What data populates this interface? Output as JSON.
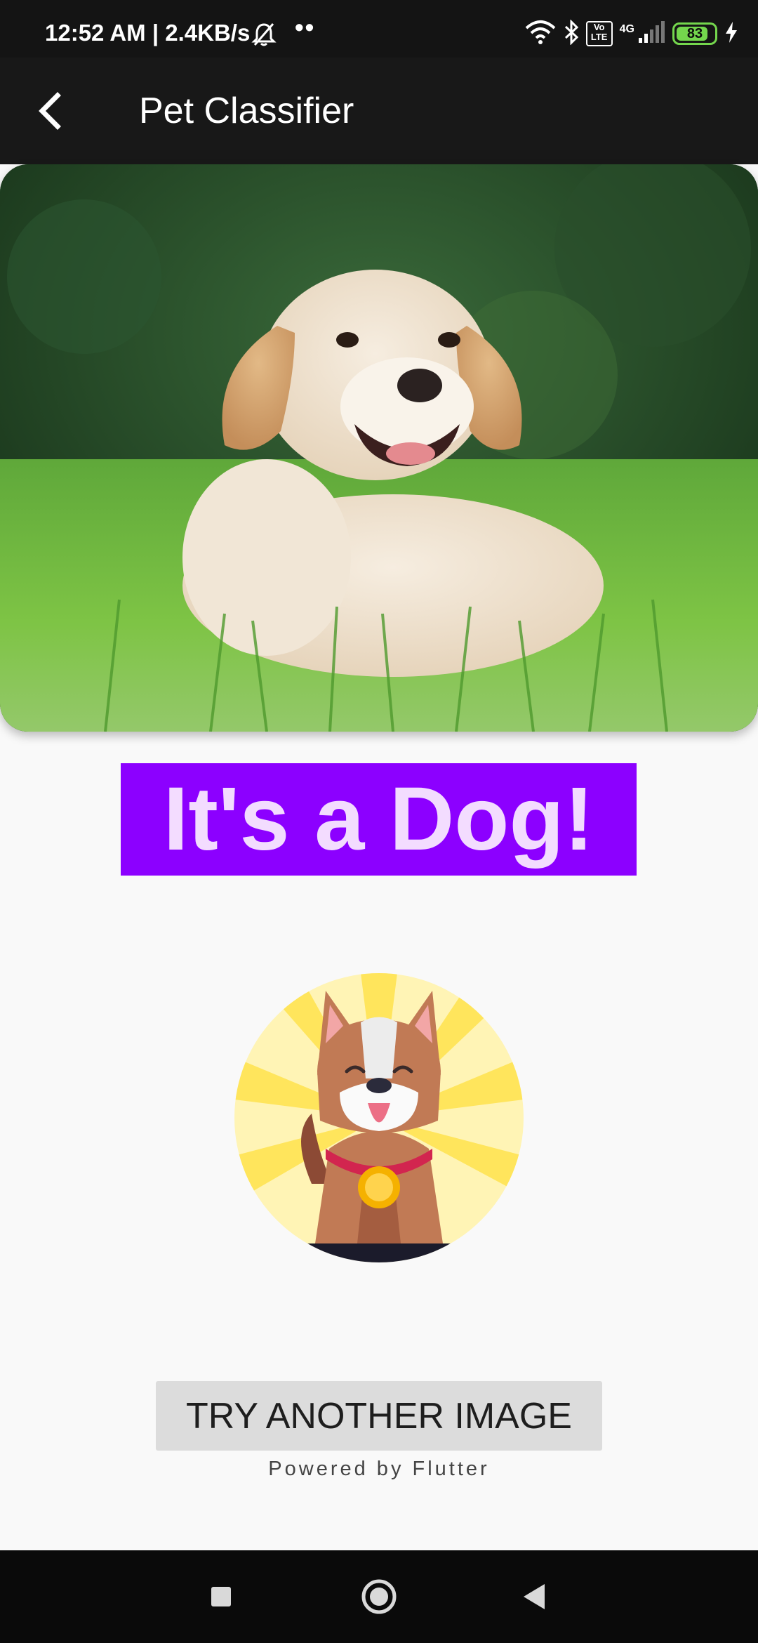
{
  "status_bar": {
    "time_speed": "12:52 AM | 2.4KB/s",
    "dots": "••",
    "network": "4G",
    "volte": "Vo LTE",
    "battery": "83"
  },
  "app_bar": {
    "title": "Pet Classifier"
  },
  "result": {
    "label": "It's a Dog!"
  },
  "actions": {
    "try_again_label": "TRY ANOTHER IMAGE"
  },
  "footer": {
    "powered_by": "Powered by Flutter"
  },
  "colors": {
    "result_bg": "#8c00ff",
    "result_text": "#f3dcff",
    "app_bar": "#181818",
    "battery": "#74d64d"
  },
  "icons": [
    "mute-icon",
    "wifi-icon",
    "bluetooth-icon",
    "volte-icon",
    "signal-icon",
    "battery-icon",
    "charging-icon",
    "back-arrow-icon",
    "square-nav-icon",
    "circle-nav-icon",
    "triangle-nav-icon"
  ]
}
